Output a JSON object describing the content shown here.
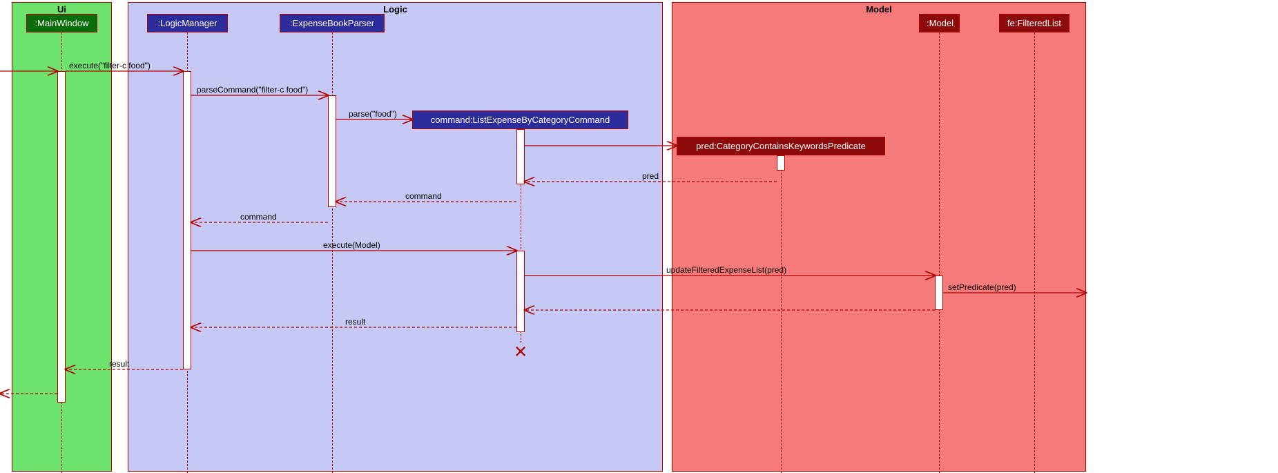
{
  "containers": {
    "ui": "Ui",
    "logic": "Logic",
    "model": "Model"
  },
  "lifelines": {
    "mainwindow": ":MainWindow",
    "logicmanager": ":LogicManager",
    "parser": ":ExpenseBookParser",
    "command": "command:ListExpenseByCategoryCommand",
    "pred": "pred:CategoryContainsKeywordsPredicate",
    "modelobj": ":Model",
    "filteredlist": "fe:FilteredList"
  },
  "messages": {
    "m1": "execute(\"filter-c food\")",
    "m2": "parseCommand(\"filter-c food\")",
    "m3": "parse(\"food\")",
    "m4": "pred",
    "m5": "command",
    "m6": "command",
    "m7": "execute(Model)",
    "m8": "updateFilteredExpenseList(pred)",
    "m9": "setPredicate(pred)",
    "m10": "result",
    "m11": "result"
  }
}
